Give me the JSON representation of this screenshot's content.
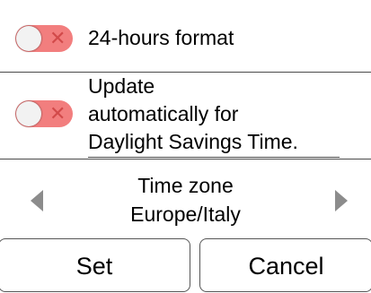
{
  "toggles": [
    {
      "label": "24-hours format",
      "state": "off"
    },
    {
      "label_lines": [
        "Update",
        "automatically for",
        "Daylight Savings Time."
      ],
      "state": "off"
    }
  ],
  "timezone": {
    "title": "Time zone",
    "value": "Europe/Italy"
  },
  "buttons": {
    "set_label": "Set",
    "cancel_label": "Cancel"
  },
  "colors": {
    "toggle_off": "#f27e7e",
    "divider": "#4a4a4a",
    "arrow": "#8c8c8c"
  },
  "icons": {
    "prev": "chevron-left-icon",
    "next": "chevron-right-icon",
    "toggle_x": "close-icon"
  }
}
